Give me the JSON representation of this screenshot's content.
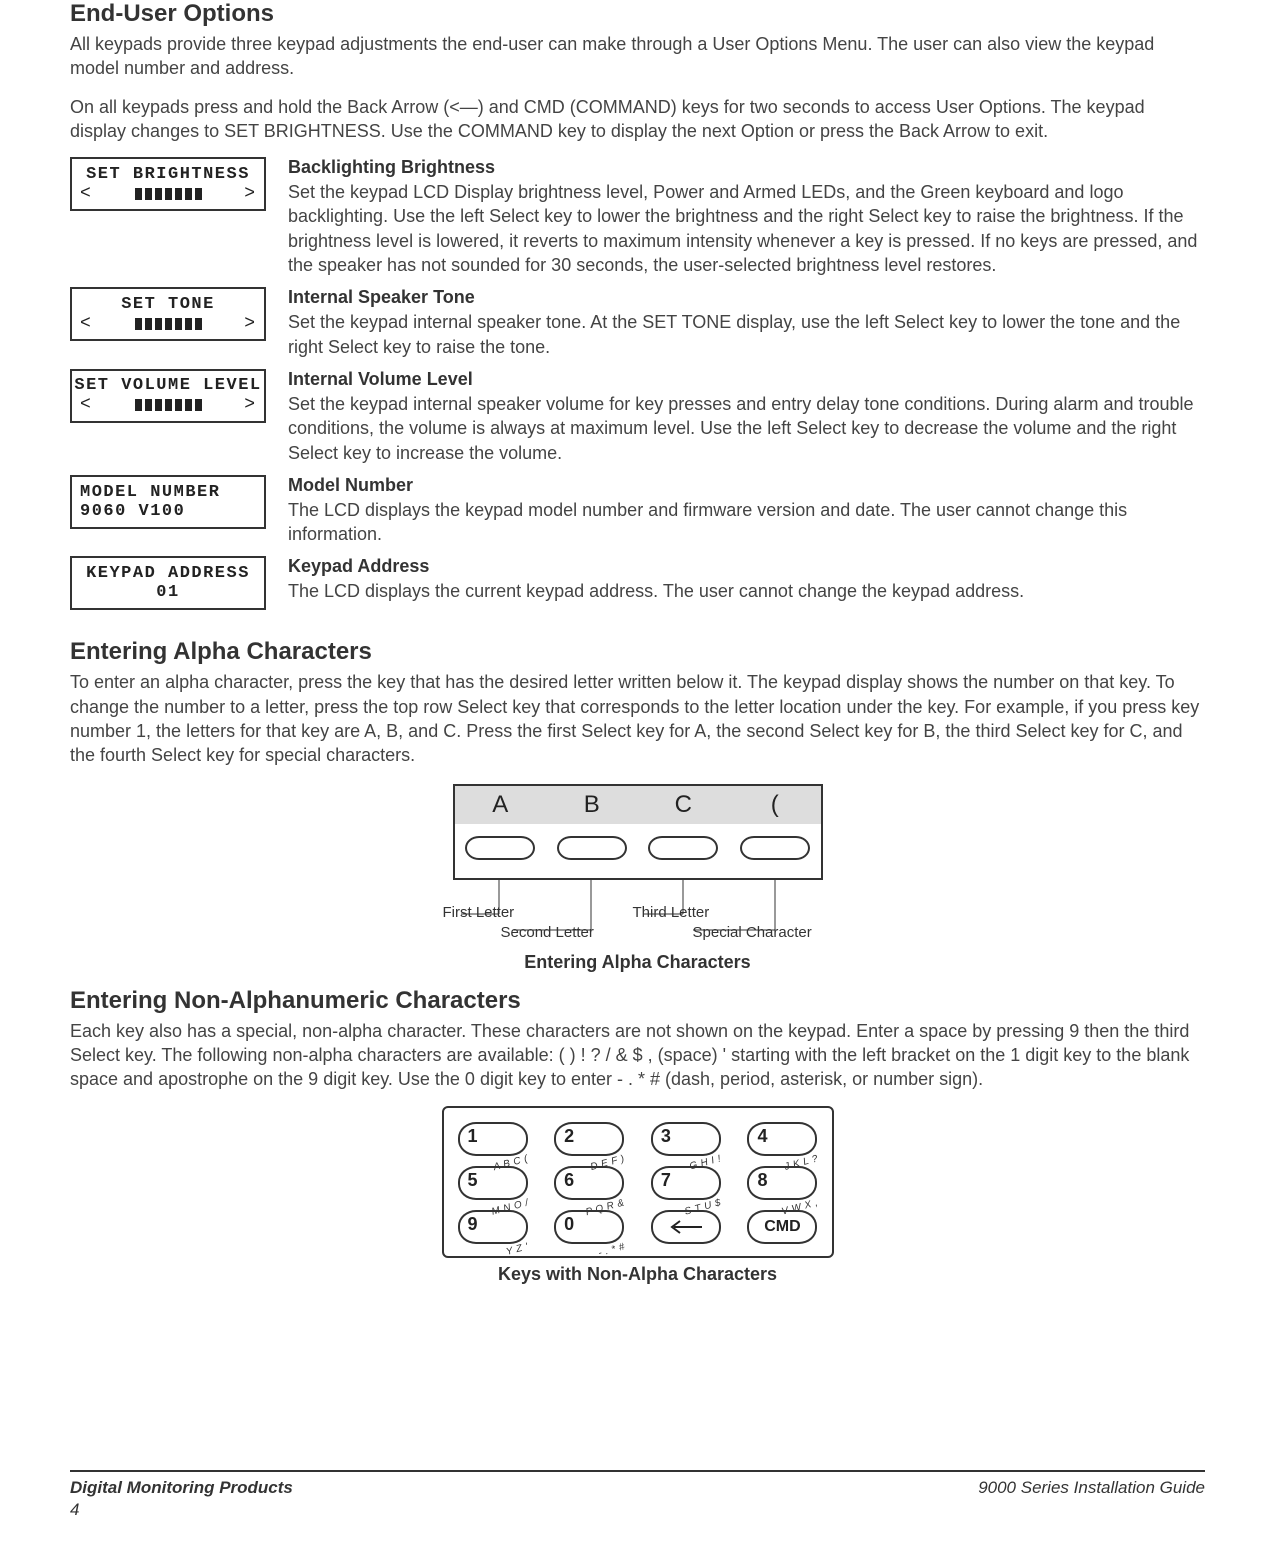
{
  "headings": {
    "end_user_options": "End-User Options",
    "entering_alpha": "Entering Alpha Characters",
    "entering_nonalpha": "Entering Non-Alphanumeric Characters"
  },
  "intro": {
    "p1": "All keypads provide three keypad adjustments the end-user can make through a User Options Menu.  The user can also view the keypad model number and address.",
    "p2": "On all keypads press and hold the Back Arrow (<—) and CMD (COMMAND) keys for two seconds to access User Options.  The keypad display changes to SET BRIGHTNESS.  Use the COMMAND key to display the next Option or press the Back Arrow to exit."
  },
  "options": [
    {
      "lcd": {
        "line1": "SET BRIGHTNESS",
        "barRow": true,
        "line2": ""
      },
      "title": "Backlighting Brightness",
      "desc": "Set the keypad LCD Display brightness level, Power and Armed LEDs, and the Green keyboard and logo backlighting.  Use the left Select key to lower the brightness and the right Select key to raise the brightness.  If the brightness level is lowered, it reverts to maximum intensity whenever a key is pressed.  If no keys are pressed, and the speaker has not sounded for 30 seconds, the user-selected brightness level restores."
    },
    {
      "lcd": {
        "line1": "SET TONE",
        "barRow": true,
        "line2": ""
      },
      "title": "Internal Speaker Tone",
      "desc": "Set the keypad internal speaker tone.  At the SET TONE display, use the left Select key to lower the tone and the right Select key to raise the tone."
    },
    {
      "lcd": {
        "line1": "SET VOLUME LEVEL",
        "barRow": true,
        "line2": ""
      },
      "title": "Internal Volume Level",
      "desc": "Set the keypad internal speaker volume for key presses and entry delay tone conditions.  During alarm and trouble conditions, the volume is always at maximum level.  Use the left Select key to decrease the volume and the right Select key to increase the volume."
    },
    {
      "lcd": {
        "line1": "MODEL NUMBER",
        "barRow": false,
        "line2": "9060 V100"
      },
      "title": "Model Number",
      "desc": "The LCD displays the keypad model number and firmware version and date.  The user cannot change this information."
    },
    {
      "lcd": {
        "line1": "KEYPAD ADDRESS",
        "barRow": false,
        "line2": "01",
        "center": true
      },
      "title": "Keypad Address",
      "desc": "The LCD displays the current keypad address.  The user cannot change the keypad address."
    }
  ],
  "alpha": {
    "body": "To enter an alpha character, press the key that has the desired letter written below it.  The keypad display shows the number on that key. To change the number to a letter, press the top row Select key that corresponds to the letter location under the key. For example, if you press key number 1, the letters for that key are A, B, and C. Press the first Select key for A, the second Select key for B, the third Select key for C, and the fourth Select key for special characters.",
    "display": [
      "A",
      "B",
      "C",
      "("
    ],
    "labels": {
      "first": "First Letter",
      "second": "Second Letter",
      "third": "Third Letter",
      "special": "Special Character"
    },
    "caption": "Entering Alpha Characters"
  },
  "nonalpha": {
    "body": "Each key also has a special, non-alpha character.  These characters are not shown on the keypad.  Enter a space by pressing 9 then the third Select key.  The following non-alpha characters are available: ( ) ! ? / & $ , (space) ' starting with the left bracket on the 1 digit key to the blank space and apostrophe on the 9 digit key.  Use the 0 digit key to enter - . * # (dash, period, asterisk, or number sign).",
    "keys": [
      [
        {
          "digit": "1",
          "sub": "A B C ("
        },
        {
          "digit": "2",
          "sub": "D E F )"
        },
        {
          "digit": "3",
          "sub": "G H I !"
        },
        {
          "digit": "4",
          "sub": "J K L ?"
        }
      ],
      [
        {
          "digit": "5",
          "sub": "M N O /"
        },
        {
          "digit": "6",
          "sub": "P Q R &"
        },
        {
          "digit": "7",
          "sub": "S T U $"
        },
        {
          "digit": "8",
          "sub": "V W X ,"
        }
      ],
      [
        {
          "digit": "9",
          "sub": "Y Z   '"
        },
        {
          "digit": "0",
          "sub": "- . * #"
        },
        {
          "arrow": true
        },
        {
          "cmd": "CMD"
        }
      ]
    ],
    "caption": "Keys with Non-Alpha Characters"
  },
  "footer": {
    "left": "Digital Monitoring Products",
    "right": "9000 Series Installation Guide",
    "page": "4"
  }
}
